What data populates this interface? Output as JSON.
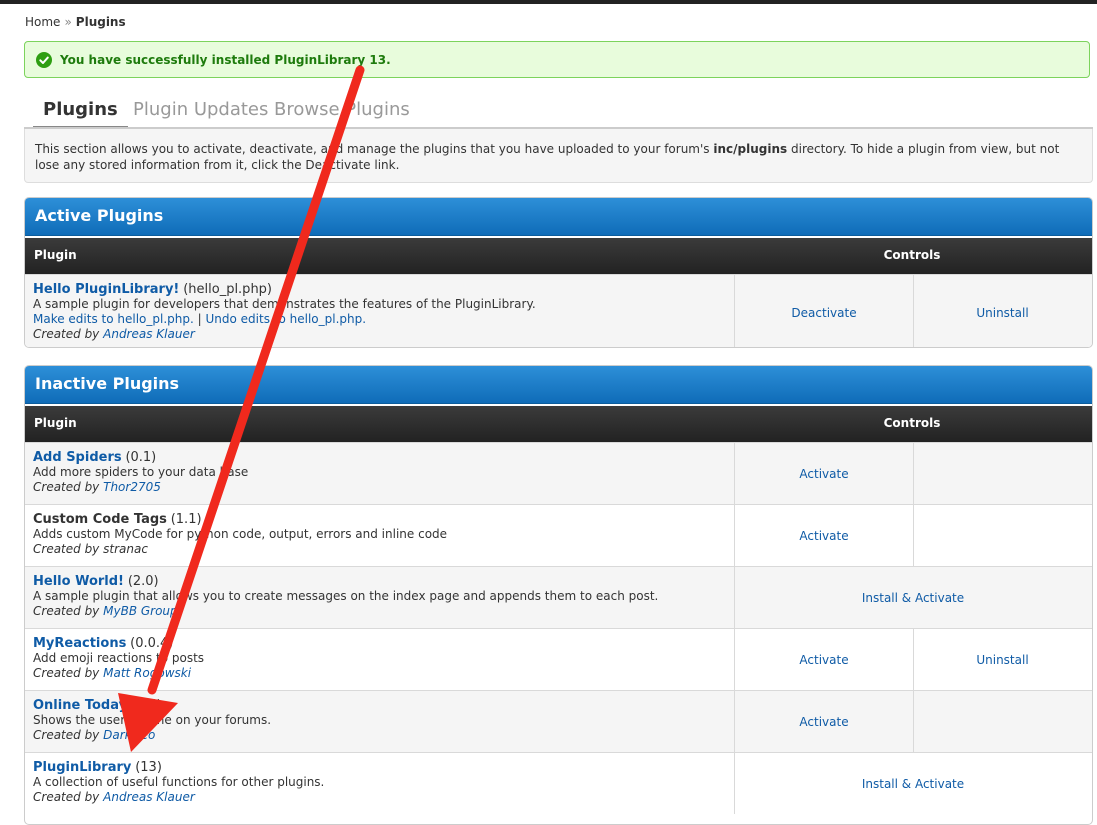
{
  "breadcrumb": {
    "home": "Home",
    "separator": "»",
    "current": "Plugins"
  },
  "success_message": "You have successfully installed PluginLibrary 13.",
  "tabs": [
    {
      "label": "Plugins",
      "active": true
    },
    {
      "label": "Plugin Updates",
      "active": false
    },
    {
      "label": "Browse Plugins",
      "active": false
    }
  ],
  "intro": {
    "text_before": "This section allows you to activate, deactivate, and manage the plugins that you have uploaded to your forum's ",
    "dir": "inc/plugins",
    "text_after": " directory. To hide a plugin from view, but not lose any stored information from it, click the Deactivate link."
  },
  "active": {
    "title": "Active Plugins",
    "col_plugin": "Plugin",
    "col_controls": "Controls",
    "rows": [
      {
        "name": "Hello PluginLibrary!",
        "version": "(hello_pl.php)",
        "description": "A sample plugin for developers that demonstrates the features of the PluginLibrary.",
        "edit_link": "Make edits to hello_pl.php.",
        "edit_sep": "|",
        "undo_link": "Undo edits to hello_pl.php.",
        "created_by": "Created by",
        "author": "Andreas Klauer",
        "control1": "Deactivate",
        "control2": "Uninstall"
      }
    ]
  },
  "inactive": {
    "title": "Inactive Plugins",
    "col_plugin": "Plugin",
    "col_controls": "Controls",
    "rows": [
      {
        "name": "Add Spiders",
        "version": "(0.1)",
        "description": "Add more spiders to your data base",
        "created_by": "Created by",
        "author": "Thor2705",
        "control1": "Activate",
        "control2": ""
      },
      {
        "name": "Custom Code Tags",
        "version": "(1.1)",
        "description": "Adds custom MyCode for python code, output, errors and inline code",
        "created_by": "Created by",
        "author": "stranac",
        "control1": "Activate",
        "control2": ""
      },
      {
        "name": "Hello World!",
        "version": "(2.0)",
        "description": "A sample plugin that allows you to create messages on the index page and appends them to each post.",
        "created_by": "Created by",
        "author": "MyBB Group",
        "control_wide": "Install & Activate"
      },
      {
        "name": "MyReactions",
        "version": "(0.0.4)",
        "description": "Add emoji reactions to posts",
        "created_by": "Created by",
        "author": "Matt Rogowski",
        "control1": "Activate",
        "control2": "Uninstall"
      },
      {
        "name": "Online Today",
        "version": "(2.5)",
        "description": "Shows the users online on your forums.",
        "created_by": "Created by",
        "author": "DarkNeo",
        "control1": "Activate",
        "control2": ""
      },
      {
        "name": "PluginLibrary",
        "version": "(13)",
        "description": "A collection of useful functions for other plugins.",
        "created_by": "Created by",
        "author": "Andreas Klauer",
        "control_wide": "Install & Activate"
      }
    ]
  },
  "colors": {
    "accent_blue": "#0f5ba6",
    "header_blue": "#1a7acb",
    "success_green": "#1e7b0d",
    "arrow_red": "#f0291d"
  }
}
